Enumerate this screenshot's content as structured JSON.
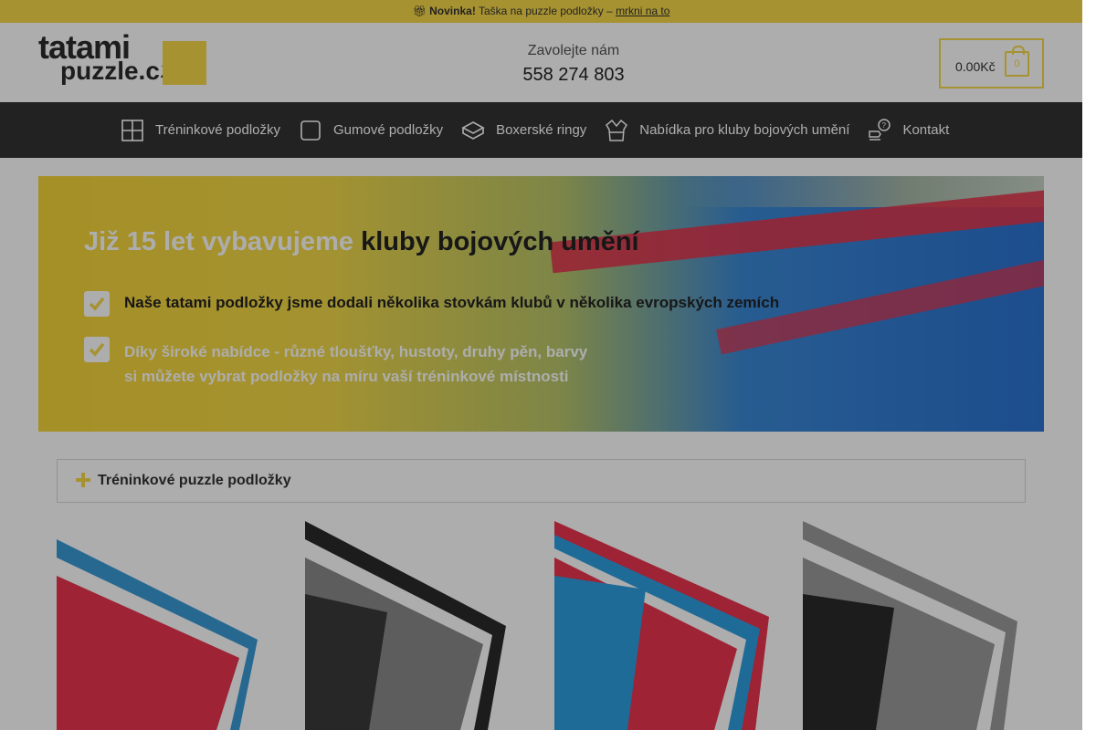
{
  "topbar": {
    "icon": "gift-icon",
    "new_label": "Novinka!",
    "text": "Taška na puzzle podložky –",
    "link": "mrkni na to"
  },
  "header": {
    "logo_line1": "tatami",
    "logo_line2": "puzzle.cz",
    "call_label": "Zavolejte nám",
    "phone": "558 274 803",
    "cart_total": "0.00Kč",
    "cart_count": "0"
  },
  "nav": {
    "items": [
      {
        "label": "Tréninkové podložky",
        "icon": "training-mat-icon"
      },
      {
        "label": "Gumové podložky",
        "icon": "rubber-mat-icon"
      },
      {
        "label": "Boxerské ringy",
        "icon": "boxing-ring-icon"
      },
      {
        "label": "Nabídka pro kluby bojových umění",
        "icon": "kimono-icon"
      },
      {
        "label": "Kontakt",
        "icon": "contact-icon"
      }
    ]
  },
  "hero": {
    "title_part1": "Již 15 let vybavujeme",
    "title_part2": "kluby bojových umění",
    "bullet1": "Naše tatami podložky jsme dodali několika stovkám klubů v několika evropských zemích",
    "bullet2_line1": "Díky široké nabídce - různé tloušťky, hustoty, druhy pěn, barvy",
    "bullet2_line2": "si můžete vybrat podložky na míru vaší tréninkové místnosti"
  },
  "accordion": {
    "label": "Tréninkové puzzle podložky"
  },
  "products": [
    {
      "name": "red-blue-puzzle-mat",
      "colors": [
        "#e8344f",
        "#3a9ad6"
      ]
    },
    {
      "name": "black-grey-puzzle-mat",
      "colors": [
        "#2a2a2a",
        "#8a8a8a"
      ]
    },
    {
      "name": "blue-red-puzzle-mat",
      "colors": [
        "#2f9ee0",
        "#e8344f"
      ]
    },
    {
      "name": "grey-black-puzzle-mat",
      "colors": [
        "#9a9a9a",
        "#2a2a2a"
      ]
    }
  ],
  "colors": {
    "accent": "#f6d84a",
    "nav_bg": "#333333"
  }
}
